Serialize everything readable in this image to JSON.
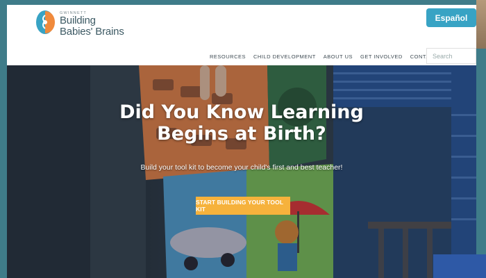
{
  "header": {
    "logo": {
      "small": "GWINNETT",
      "line1": "Building",
      "line2": "Babies' Brains"
    },
    "language_button": "Español",
    "nav": [
      "RESOURCES",
      "CHILD DEVELOPMENT",
      "ABOUT US",
      "GET INVOLVED",
      "CONTACT US"
    ],
    "search": {
      "placeholder": "Search"
    }
  },
  "hero": {
    "title_line1": "Did You Know Learning",
    "title_line2": "Begins at Birth?",
    "subtitle": "Build your tool kit to become your child's first and best teacher!",
    "cta": "START BUILDING YOUR TOOL KIT"
  },
  "colors": {
    "brand_teal": "#38a3c4",
    "cta_orange": "#f6b23c",
    "page_bg": "#3f7c89",
    "logo_blue": "#38a3c4",
    "logo_orange": "#f08a3c"
  }
}
